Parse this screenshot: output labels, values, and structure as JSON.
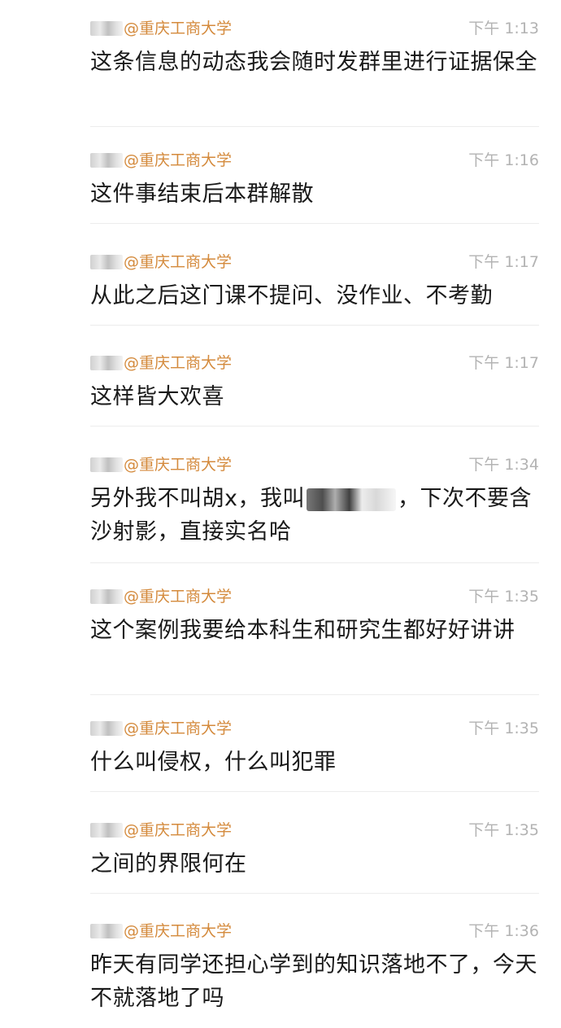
{
  "messages": [
    {
      "org": "@重庆工商大学",
      "time": "下午 1:13",
      "text": "这条信息的动态我会随时发群里进行证据保全"
    },
    {
      "org": "@重庆工商大学",
      "time": "下午 1:16",
      "text": "这件事结束后本群解散"
    },
    {
      "org": "@重庆工商大学",
      "time": "下午 1:17",
      "text": "从此之后这门课不提问、没作业、不考勤"
    },
    {
      "org": "@重庆工商大学",
      "time": "下午 1:17",
      "text": "这样皆大欢喜"
    },
    {
      "org": "@重庆工商大学",
      "time": "下午 1:34",
      "text_before": "另外我不叫胡x，我叫",
      "text_after": "，下次不要含沙射影，直接实名哈"
    },
    {
      "org": "@重庆工商大学",
      "time": "下午 1:35",
      "text": "这个案例我要给本科生和研究生都好好讲讲"
    },
    {
      "org": "@重庆工商大学",
      "time": "下午 1:35",
      "text": "什么叫侵权，什么叫犯罪"
    },
    {
      "org": "@重庆工商大学",
      "time": "下午 1:35",
      "text": "之间的界限何在"
    },
    {
      "org": "@重庆工商大学",
      "time": "下午 1:36",
      "text": "昨天有同学还担心学到的知识落地不了，今天不就落地了吗"
    }
  ]
}
